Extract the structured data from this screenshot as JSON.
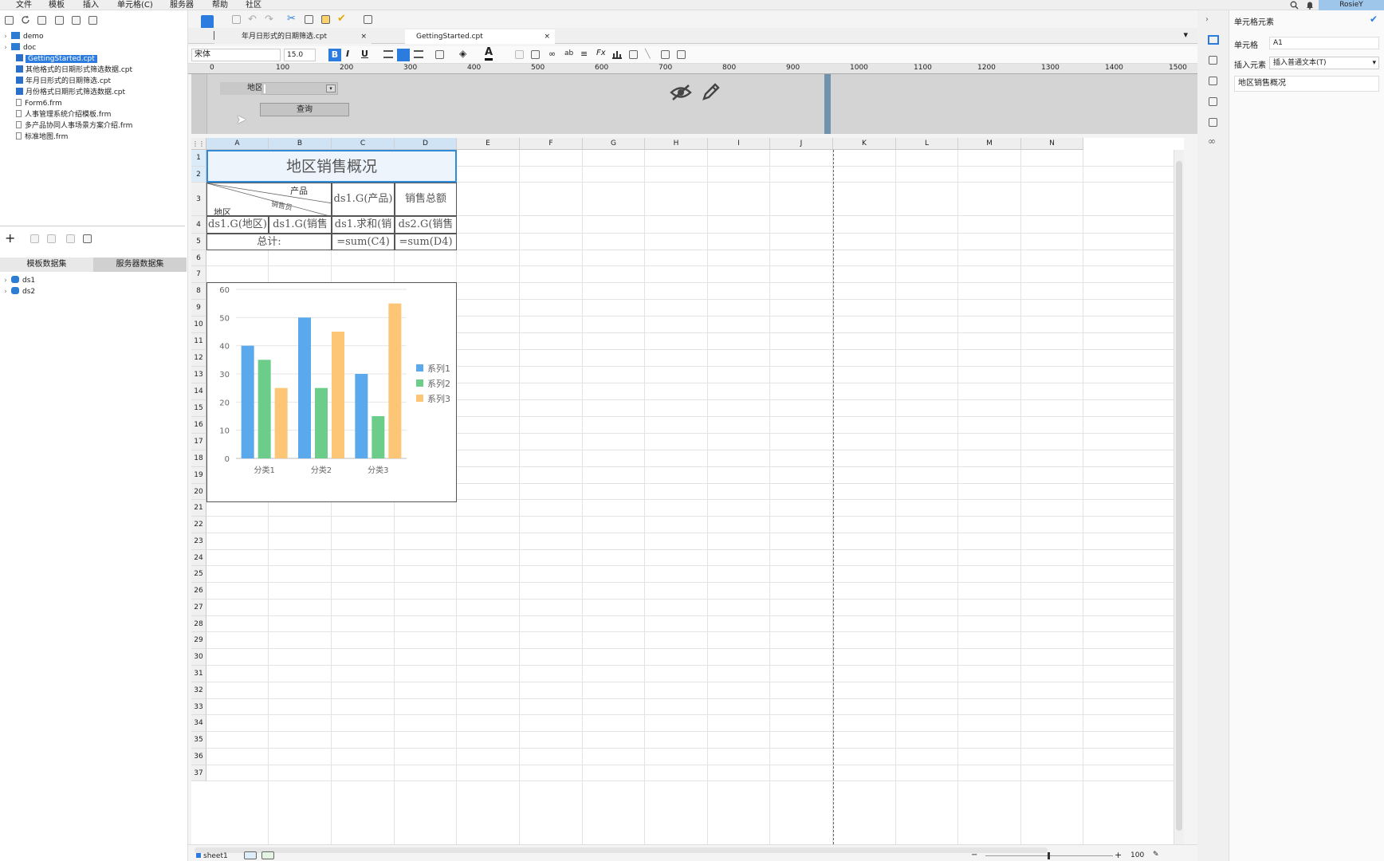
{
  "menus": [
    "文件",
    "模板",
    "插入",
    "单元格(C)",
    "服务器",
    "帮助",
    "社区"
  ],
  "user": "RosieY",
  "file_tree": [
    {
      "label": "demo",
      "kind": "folder"
    },
    {
      "label": "doc",
      "kind": "folder"
    },
    {
      "label": "GettingStarted.cpt",
      "kind": "cpt",
      "selected": true
    },
    {
      "label": "其他格式的日期形式筛选数据.cpt",
      "kind": "cpt"
    },
    {
      "label": "年月日形式的日期筛选.cpt",
      "kind": "cpt"
    },
    {
      "label": "月份格式日期形式筛选数据.cpt",
      "kind": "cpt"
    },
    {
      "label": "Form6.frm",
      "kind": "frm"
    },
    {
      "label": "人事管理系统介绍模板.frm",
      "kind": "frm"
    },
    {
      "label": "多产品协同人事场景方案介绍.frm",
      "kind": "frm"
    },
    {
      "label": "标准地图.frm",
      "kind": "frm"
    }
  ],
  "dataset_tabs": [
    "模板数据集",
    "服务器数据集"
  ],
  "datasets": [
    "ds1",
    "ds2"
  ],
  "doc_tabs": [
    "年月日形式的日期筛选.cpt",
    "GettingStarted.cpt"
  ],
  "font": {
    "name": "宋体",
    "size": "15.0"
  },
  "ruler_marks": [
    "100",
    "200",
    "300",
    "400",
    "500",
    "600",
    "700",
    "800",
    "900",
    "1000",
    "1100",
    "1200",
    "1300",
    "1400",
    "1500"
  ],
  "param": {
    "label": "地区",
    "query_button": "查询"
  },
  "columns": [
    "A",
    "B",
    "C",
    "D",
    "E",
    "F",
    "G",
    "H",
    "I",
    "J",
    "K",
    "L",
    "M",
    "N"
  ],
  "rows": [
    "1",
    "2",
    "3",
    "4",
    "5",
    "6",
    "7",
    "8",
    "9",
    "10",
    "11",
    "12",
    "13",
    "14",
    "15",
    "16",
    "17",
    "18",
    "19",
    "20",
    "21",
    "22",
    "23",
    "24",
    "25",
    "26",
    "27",
    "28",
    "29",
    "30",
    "31",
    "32",
    "33",
    "34",
    "35",
    "36",
    "37"
  ],
  "report": {
    "title": "地区销售概况",
    "slash_top": "产品",
    "slash_mid": "销售员",
    "slash_bottom": "地区",
    "c3": "ds1.G(产品)",
    "d3": "销售总额",
    "a4": "ds1.G(地区)",
    "b4": "ds1.G(销售",
    "c4": "ds1.求和(销",
    "d4": "ds2.G(销售",
    "a5": "总计:",
    "c5": "=sum(C4)",
    "d5": "=sum(D4)"
  },
  "chart_data": {
    "type": "bar",
    "categories": [
      "分类1",
      "分类2",
      "分类3"
    ],
    "series": [
      {
        "name": "系列1",
        "values": [
          40,
          50,
          30
        ],
        "color": "#5aa9ec"
      },
      {
        "name": "系列2",
        "values": [
          35,
          25,
          15
        ],
        "color": "#6ccd8a"
      },
      {
        "name": "系列3",
        "values": [
          25,
          45,
          55
        ],
        "color": "#fdc677"
      }
    ],
    "y_ticks": [
      "0",
      "10",
      "20",
      "30",
      "40",
      "50",
      "60"
    ],
    "ylim": [
      0,
      60
    ],
    "legend": "right",
    "grid": true
  },
  "status": {
    "sheet": "sheet1",
    "zoom": "100"
  },
  "panel": {
    "title": "单元格元素",
    "cell_label": "单元格",
    "cell_value": "A1",
    "insert_label": "插入元素",
    "insert_value": "插入普通文本(T)",
    "content": "地区销售概况"
  },
  "colors": {
    "accent": "#2c7ce0",
    "selection": "#2f8ad8"
  }
}
